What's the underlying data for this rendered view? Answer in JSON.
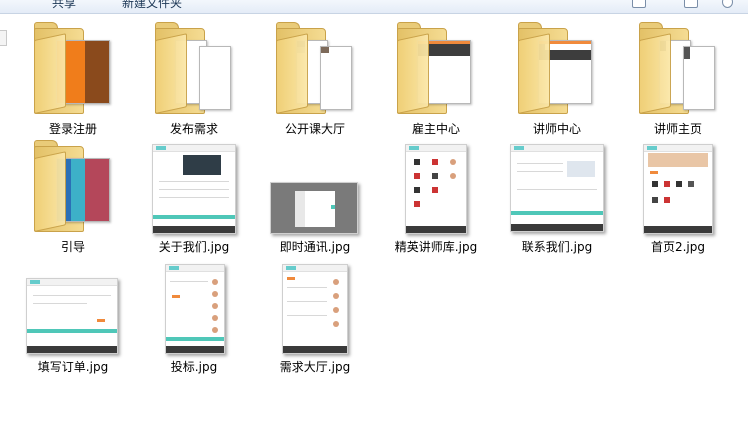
{
  "toolbar": {
    "items": [
      "共享",
      "新建文件夹"
    ]
  },
  "files": [
    {
      "name": "登录注册",
      "kind": "folder"
    },
    {
      "name": "发布需求",
      "kind": "folder"
    },
    {
      "name": "公开课大厅",
      "kind": "folder"
    },
    {
      "name": "雇主中心",
      "kind": "folder"
    },
    {
      "name": "讲师中心",
      "kind": "folder"
    },
    {
      "name": "讲师主页",
      "kind": "folder"
    },
    {
      "name": "引导",
      "kind": "folder"
    },
    {
      "name": "关于我们.jpg",
      "kind": "image"
    },
    {
      "name": "即时通讯.jpg",
      "kind": "image"
    },
    {
      "name": "精英讲师库.jpg",
      "kind": "image"
    },
    {
      "name": "联系我们.jpg",
      "kind": "image"
    },
    {
      "name": "首页2.jpg",
      "kind": "image"
    },
    {
      "name": "填写订单.jpg",
      "kind": "image"
    },
    {
      "name": "投标.jpg",
      "kind": "image"
    },
    {
      "name": "需求大厅.jpg",
      "kind": "image"
    }
  ],
  "colors": {
    "folder": "#f0d078",
    "accent_teal": "#4fc7b8",
    "accent_orange": "#f08a3c"
  }
}
